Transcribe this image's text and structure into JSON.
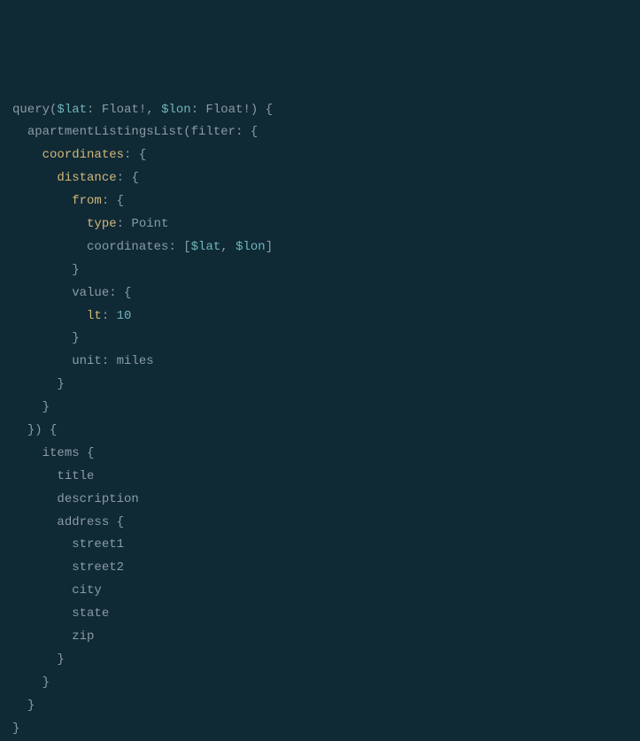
{
  "code": {
    "keyword_query": "query",
    "var_lat": "$lat",
    "var_lon": "$lon",
    "type_float": "Float",
    "func_apartments": "apartmentListingsList",
    "kw_filter": "filter",
    "kw_coordinates": "coordinates",
    "kw_distance": "distance",
    "kw_from": "from",
    "kw_type": "type",
    "val_point": "Point",
    "kw_value": "value",
    "kw_lt": "lt",
    "num_10": "10",
    "kw_unit": "unit",
    "val_miles": "miles",
    "kw_items": "items",
    "kw_title": "title",
    "kw_description": "description",
    "kw_address": "address",
    "kw_street1": "street1",
    "kw_street2": "street2",
    "kw_city": "city",
    "kw_state": "state",
    "kw_zip": "zip"
  }
}
